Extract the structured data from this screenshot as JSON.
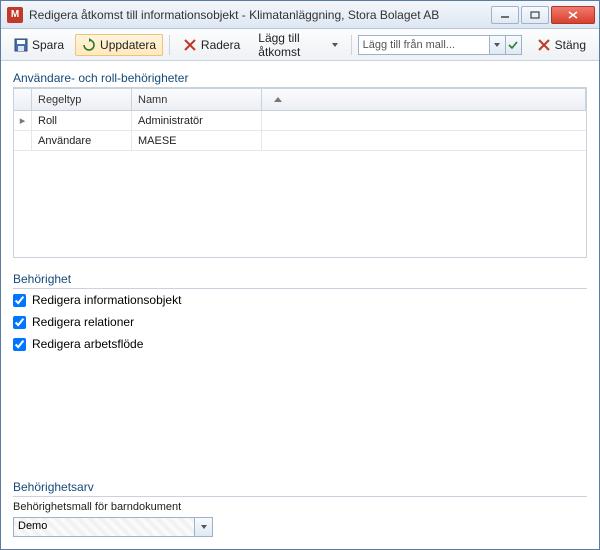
{
  "window": {
    "title": "Redigera åtkomst till informationsobjekt - Klimatanläggning, Stora Bolaget AB"
  },
  "toolbar": {
    "save": "Spara",
    "update": "Uppdatera",
    "delete": "Radera",
    "add_access": "Lägg till åtkomst",
    "template_placeholder": "Lägg till från mall...",
    "close": "Stäng"
  },
  "sections": {
    "users_roles": "Användare- och roll-behörigheter",
    "permission": "Behörighet",
    "inheritance": "Behörighetsarv"
  },
  "grid": {
    "col_ruletype": "Regeltyp",
    "col_name": "Namn",
    "rows": [
      {
        "type": "Roll",
        "name": "Administratör",
        "selected": true
      },
      {
        "type": "Användare",
        "name": "MAESE",
        "selected": false
      }
    ]
  },
  "permissions": [
    {
      "label": "Redigera informationsobjekt",
      "checked": true
    },
    {
      "label": "Redigera relationer",
      "checked": true
    },
    {
      "label": "Redigera arbetsflöde",
      "checked": true
    }
  ],
  "inheritance": {
    "label": "Behörighetsmall för barndokument",
    "value": "Demo"
  }
}
